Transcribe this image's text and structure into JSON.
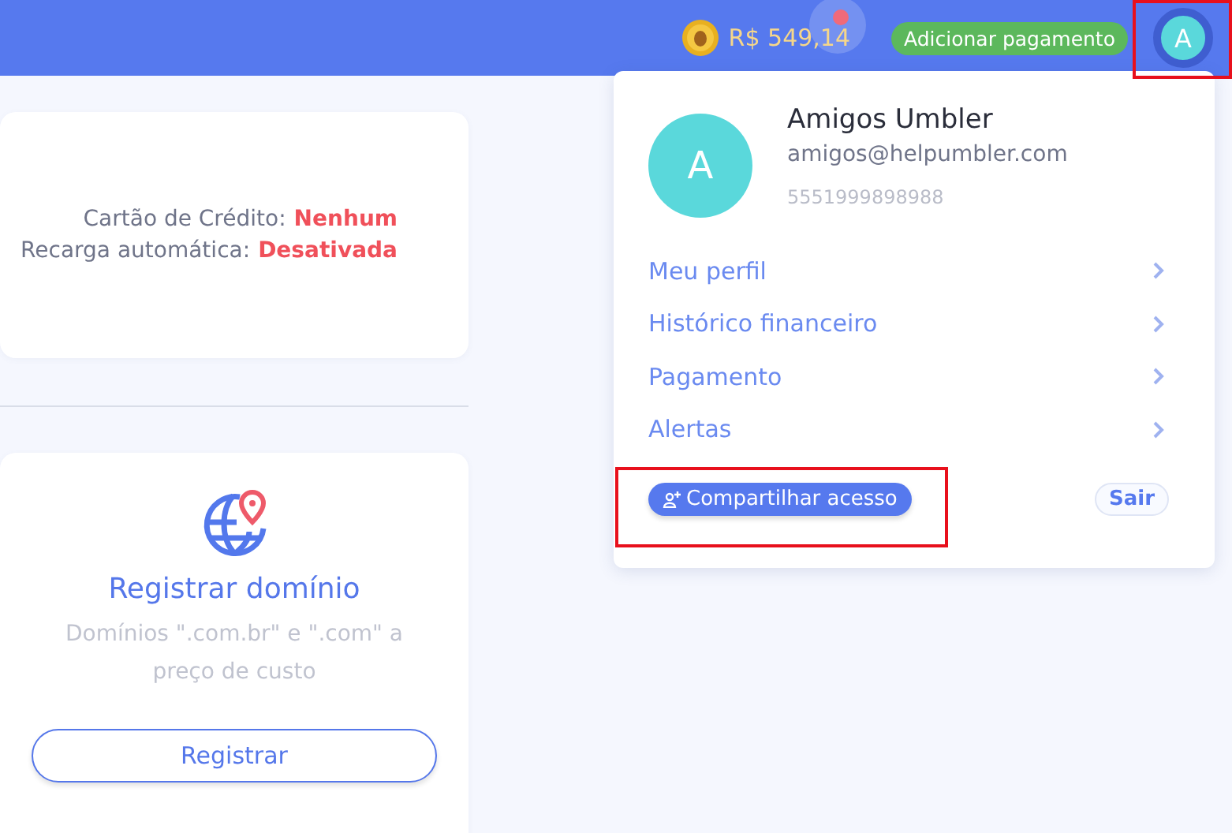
{
  "top_bar": {
    "balance": "R$ 549,14",
    "add_payment_button": "Adicionar pagamento",
    "avatar_letter": "A"
  },
  "billing_card": {
    "lines": [
      {
        "label": "Cartão de Crédito:",
        "value": "Nenhum"
      },
      {
        "label": "Recarga automática:",
        "value": "Desativada"
      }
    ]
  },
  "domain_card": {
    "title": "Registrar domínio",
    "description": "Domínios \".com.br\" e \".com\" a preço de custo",
    "button": "Registrar"
  },
  "account_menu": {
    "avatar_letter": "A",
    "name": "Amigos Umbler",
    "email": "amigos@helpumbler.com",
    "phone": "5551999898988",
    "items": [
      {
        "label": "Meu perfil"
      },
      {
        "label": "Histórico financeiro"
      },
      {
        "label": "Pagamento"
      },
      {
        "label": "Alertas"
      }
    ],
    "share_button": "Compartilhar acesso",
    "logout_button": "Sair"
  }
}
